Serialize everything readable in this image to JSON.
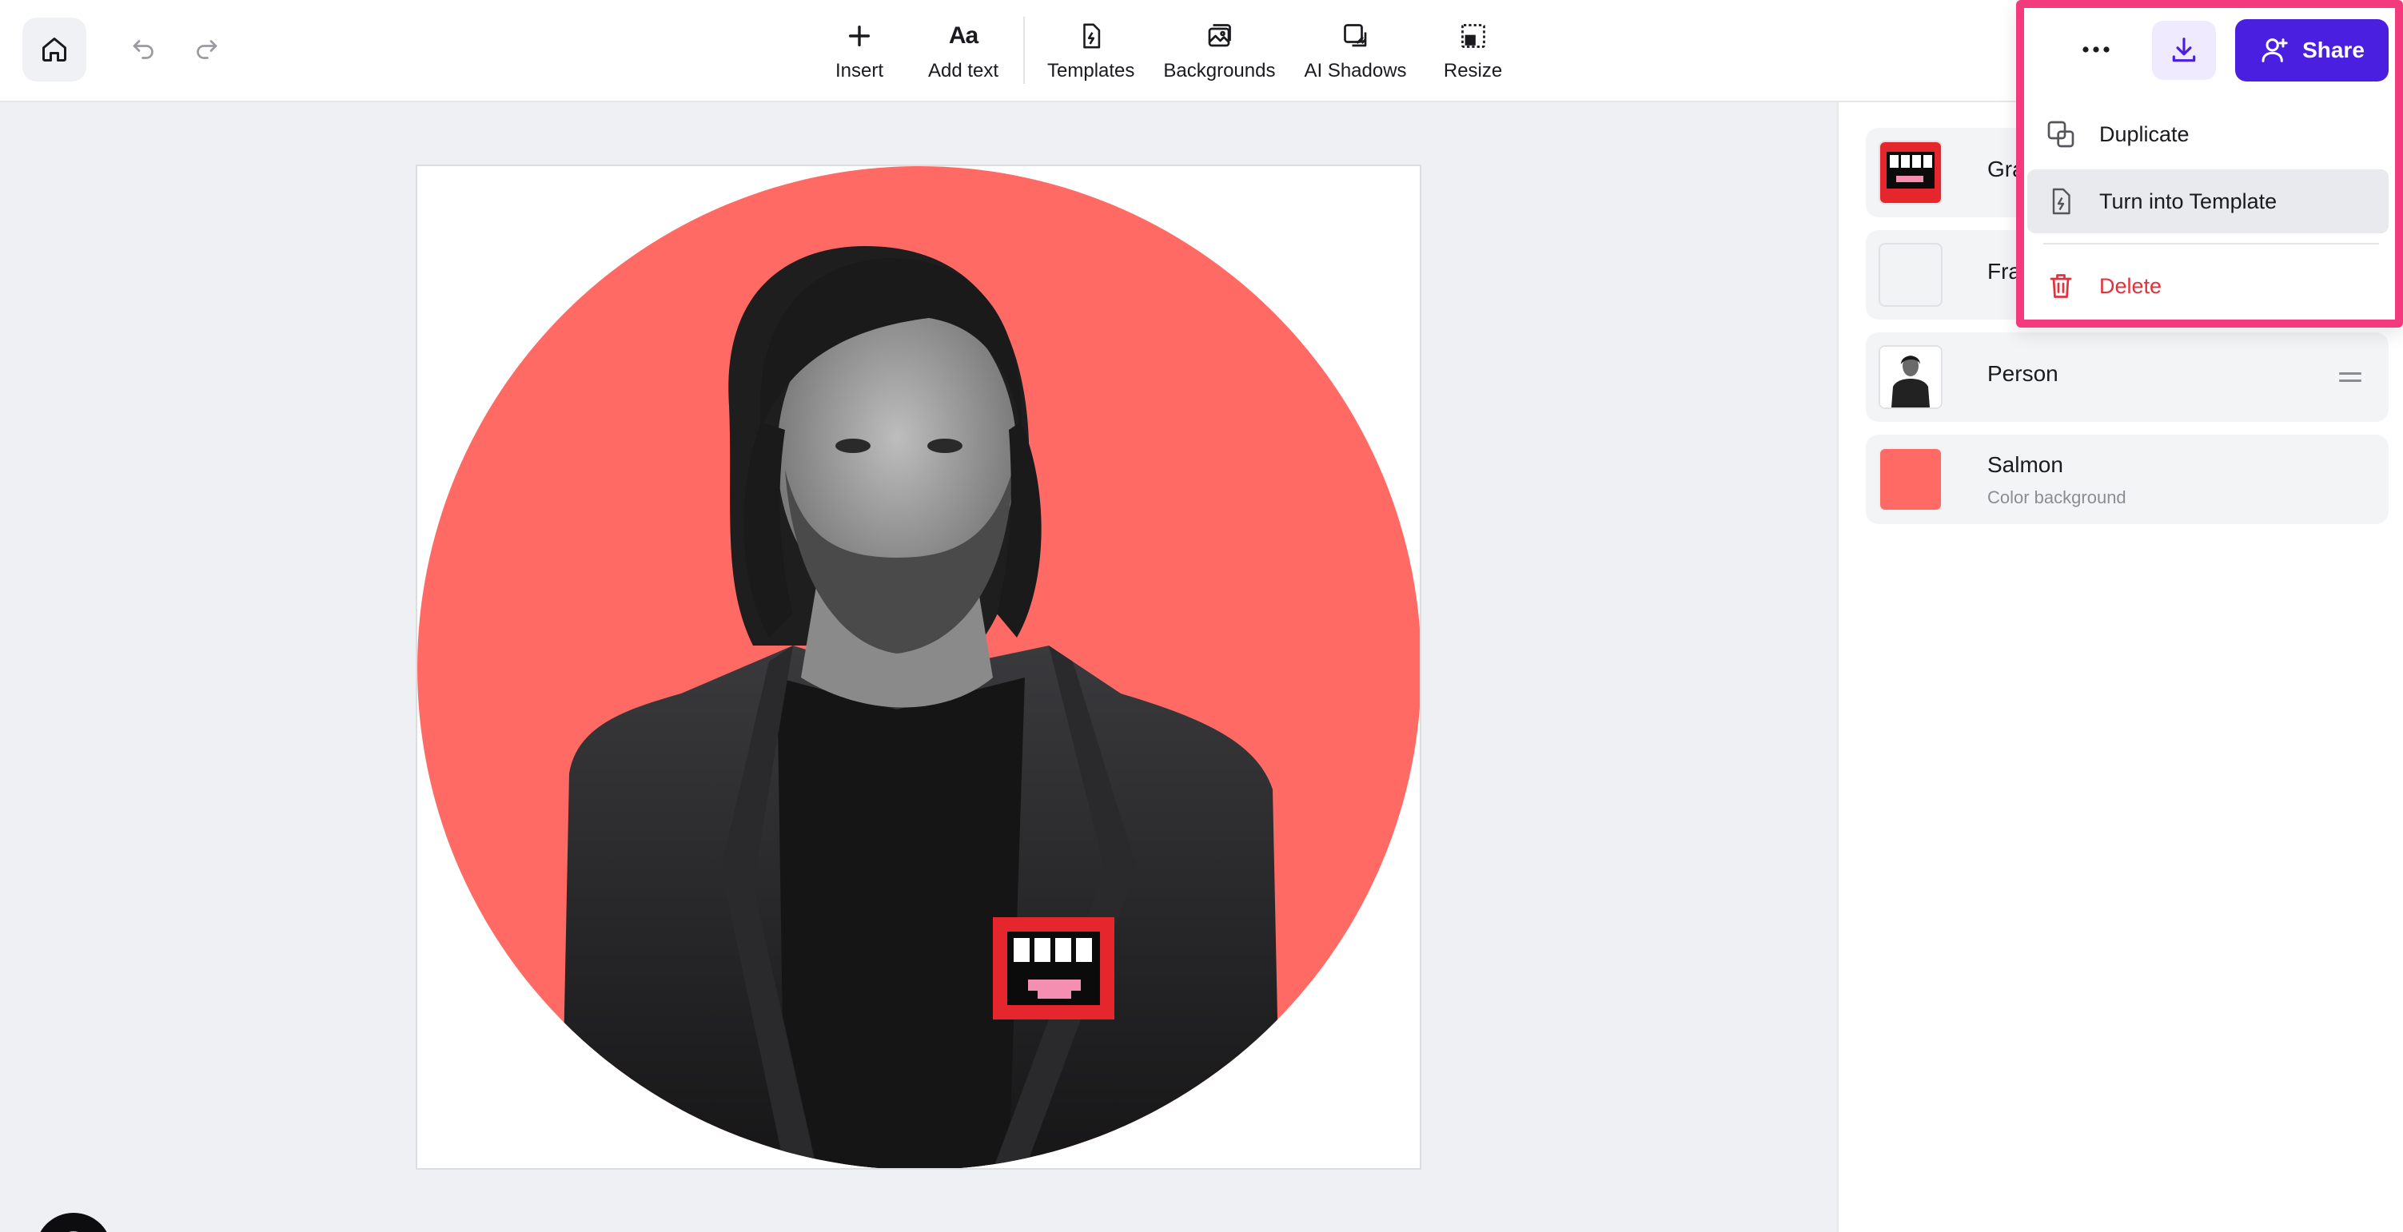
{
  "toolbar": {
    "tools": [
      {
        "label": "Insert",
        "icon": "plus-icon"
      },
      {
        "label": "Add text",
        "icon": "text-aa-icon",
        "glyph": "Aa"
      },
      {
        "label": "Templates",
        "icon": "templates-icon"
      },
      {
        "label": "Backgrounds",
        "icon": "backgrounds-icon"
      },
      {
        "label": "AI Shadows",
        "icon": "ai-shadows-icon"
      },
      {
        "label": "Resize",
        "icon": "resize-icon"
      }
    ],
    "share_label": "Share",
    "accent": "#4a1fe0"
  },
  "actions_menu": {
    "items": [
      {
        "label": "Duplicate",
        "icon": "duplicate-icon"
      },
      {
        "label": "Turn into Template",
        "icon": "template-file-icon"
      },
      {
        "label": "Delete",
        "icon": "trash-icon",
        "color": "#e0323c"
      }
    ],
    "highlight_color": "#f23a7d"
  },
  "layers": [
    {
      "name": "Graph",
      "thumb": "graphic-thumbnail"
    },
    {
      "name": "Frame",
      "thumb": "frame-thumbnail"
    },
    {
      "name": "Person",
      "thumb": "person-thumbnail"
    },
    {
      "name": "Salmon",
      "subtitle": "Color background",
      "swatch": "#ff6b64"
    }
  ],
  "canvas": {
    "background_color": "#ff6b64"
  }
}
